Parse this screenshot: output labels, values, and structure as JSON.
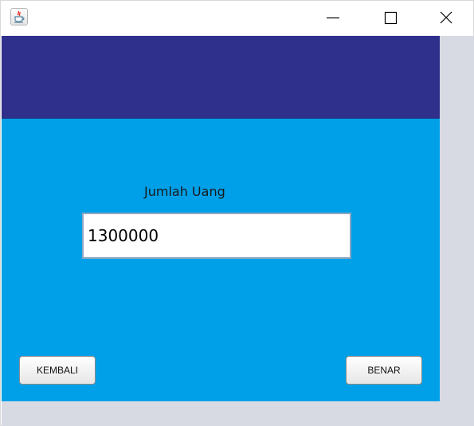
{
  "window": {
    "controls": {
      "minimize_icon": "minimize-icon",
      "maximize_icon": "maximize-icon",
      "close_icon": "close-icon"
    },
    "app_icon": "java-icon"
  },
  "form": {
    "label": "Jumlah Uang",
    "amount_value": "1300000"
  },
  "buttons": {
    "back_label": "KEMBALI",
    "confirm_label": "BENAR"
  },
  "colors": {
    "header": "#2f308b",
    "panel": "#00a0e9",
    "frame": "#d7dae3"
  }
}
